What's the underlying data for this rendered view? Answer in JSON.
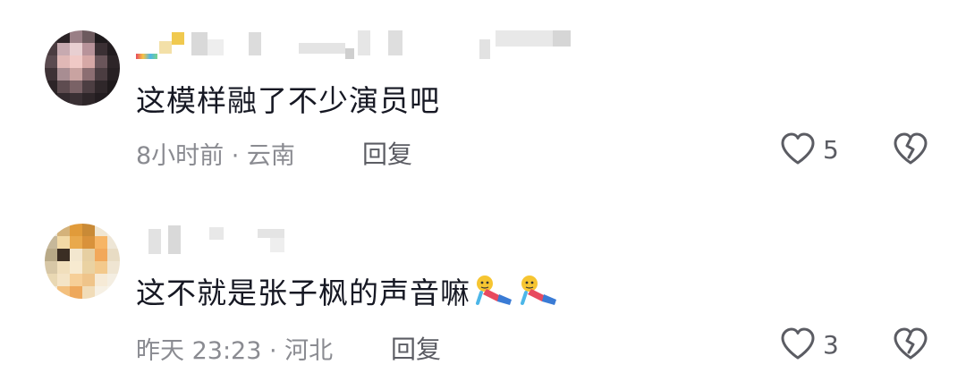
{
  "comments": [
    {
      "text": "这模样融了不少演员吧",
      "time_location": "8小时前 · 云南",
      "reply_label": "回复",
      "like_count": "5",
      "emojis": []
    },
    {
      "text": "这不就是张子枫的声音嘛",
      "time_location": "昨天 23:23 · 河北",
      "reply_label": "回复",
      "like_count": "3",
      "emojis": [
        "lying-down-emoji",
        "lying-down-emoji"
      ]
    }
  ],
  "colors": {
    "text": "#161823",
    "meta": "#8a8b91",
    "action": "#5b5c63",
    "icon_stroke": "#5b5c63"
  }
}
